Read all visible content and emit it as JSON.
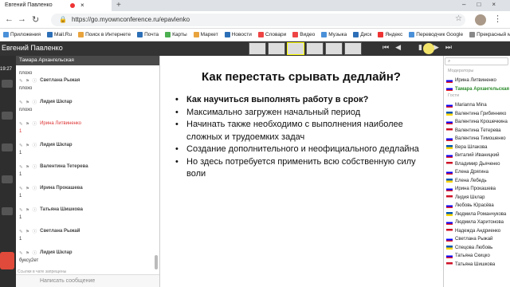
{
  "browser": {
    "tab_title": "Евгений Павленко",
    "url": "https://go.myownconference.ru/epavlenko",
    "bookmarks": [
      "Приложения",
      "Mail.Ru",
      "Поиск в Интернете",
      "Почта",
      "Карты",
      "Маркет",
      "Новости",
      "Словари",
      "Видео",
      "Музыка",
      "Диск",
      "Яндекс",
      "Переводчик Google",
      "Прекрасный мир"
    ]
  },
  "app": {
    "presenter_name": "Евгений Павленко",
    "time": "19:27",
    "chat_header": "Тамара Архангельская",
    "chat_messages": [
      {
        "name": "",
        "text": "плохо",
        "highlight": false
      },
      {
        "name": "Светлана Рыжая",
        "text": "плохо",
        "highlight": false
      },
      {
        "name": "Лидия Шклар",
        "text": "плохо",
        "highlight": false
      },
      {
        "name": "Ирина Литвиненко",
        "text": "1",
        "highlight": true
      },
      {
        "name": "Лидия Шклар",
        "text": "1",
        "highlight": false
      },
      {
        "name": "Валентина Тетерева",
        "text": "1",
        "highlight": false
      },
      {
        "name": "Ирина Прокашева",
        "text": "1",
        "highlight": false
      },
      {
        "name": "Татьяна Шишкова",
        "text": "1",
        "highlight": false
      },
      {
        "name": "Светлана Рыжай",
        "text": "1",
        "highlight": false
      },
      {
        "name": "Лидия Шклар",
        "text": "буксу2ет",
        "highlight": false
      }
    ],
    "chat_note": "Ссылки в чате запрещены",
    "chat_placeholder": "Написать сообщение"
  },
  "slide": {
    "title": "Как перестать срывать дедлайн?",
    "bullets": [
      {
        "text": "Как научиться выполнять работу в срок?",
        "bold": true
      },
      {
        "text": "Максимально загружен начальный период",
        "bold": false
      },
      {
        "text": "Начинать также необходимо с выполнения наиболее сложных и трудоемких задач",
        "bold": false
      },
      {
        "text": "Создание дополнительного и неофициального дедлайна",
        "bold": false
      },
      {
        "text": "Но здесь потребуется применить всю собственную силу воли",
        "bold": false
      }
    ]
  },
  "participants": {
    "search_placeholder": "",
    "moderators_label": "Модераторы",
    "moderators": [
      "Ирина Литвиненко",
      "Тамара Архангельская"
    ],
    "guests_label": "Гости",
    "guests": [
      "Marianna Mina",
      "Валентина Грибиннико",
      "Валентина Крошечкина",
      "Валентина Тетерева",
      "Валентина Тимошенко",
      "Вера Шлакова",
      "Виталий Иваницкий",
      "Владимир Дьяченко",
      "Елена Дрягина",
      "Елена Лебедь",
      "Ирина Прокашева",
      "Лидия Шклар",
      "Любовь Юрасёва",
      "Людмила Романчукова",
      "Людмила Харитонова",
      "Надежда Андриенко",
      "Светлана Рыжай",
      "Спецова Любовь",
      "Татьяна Скицко",
      "Татьяна Шишкова"
    ]
  }
}
